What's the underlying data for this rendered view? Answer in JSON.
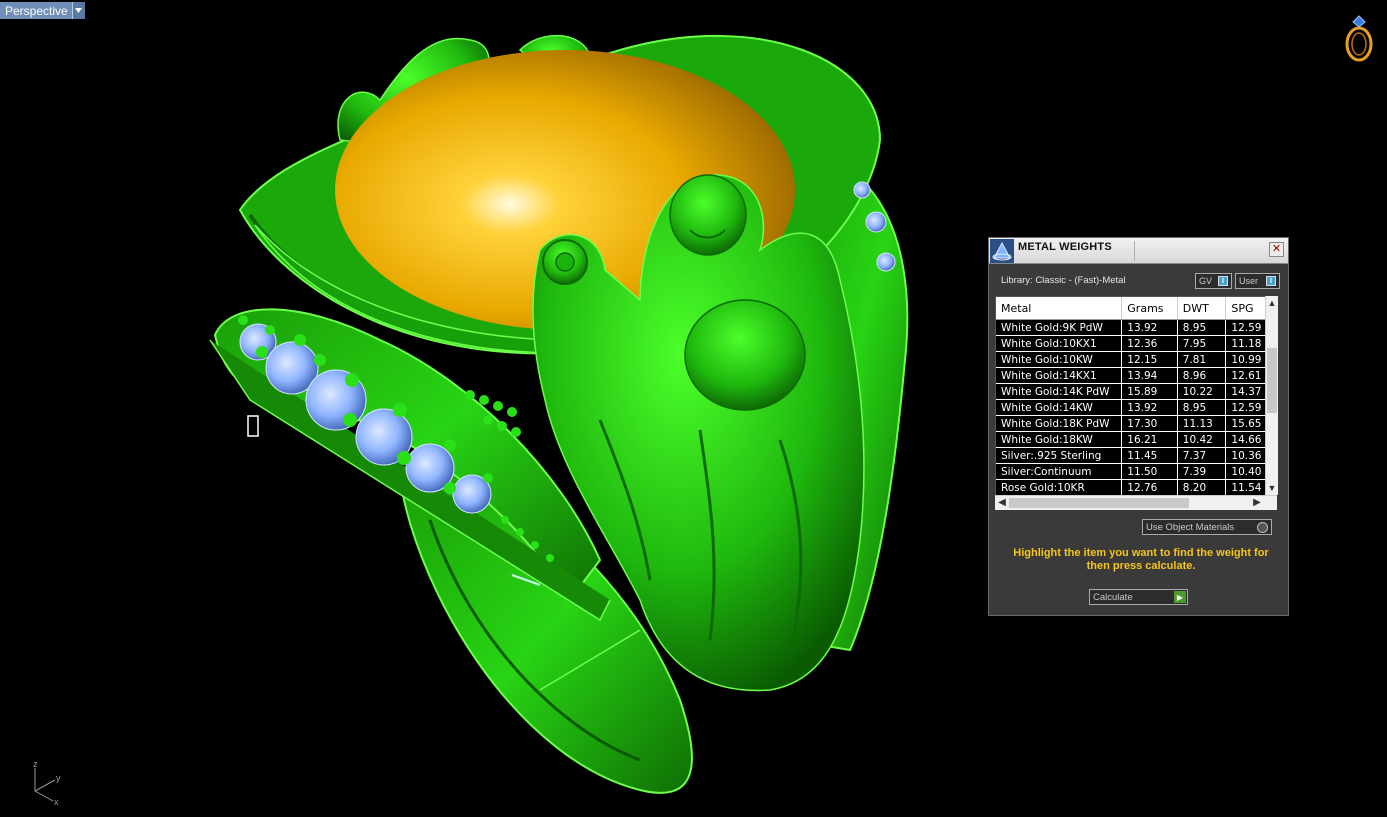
{
  "viewport": {
    "name": "Perspective",
    "axes": {
      "z": "z",
      "y": "y",
      "x": "x"
    }
  },
  "panel": {
    "title": "METAL WEIGHTS",
    "close_label": "✕",
    "library_label": "Library: Classic - (Fast)-Metal",
    "gv_label": "GV",
    "user_label": "User",
    "columns": [
      "Metal",
      "Grams",
      "DWT",
      "SPG"
    ],
    "rows": [
      [
        "White Gold:9K PdW",
        "13.92",
        "8.95",
        "12.59"
      ],
      [
        "White Gold:10KX1",
        "12.36",
        "7.95",
        "11.18"
      ],
      [
        "White Gold:10KW",
        "12.15",
        "7.81",
        "10.99"
      ],
      [
        "White Gold:14KX1",
        "13.94",
        "8.96",
        "12.61"
      ],
      [
        "White Gold:14K PdW",
        "15.89",
        "10.22",
        "14.37"
      ],
      [
        "White Gold:14KW",
        "13.92",
        "8.95",
        "12.59"
      ],
      [
        "White Gold:18K PdW",
        "17.30",
        "11.13",
        "15.65"
      ],
      [
        "White Gold:18KW",
        "16.21",
        "10.42",
        "14.66"
      ],
      [
        "Silver:.925 Sterling",
        "11.45",
        "7.37",
        "10.36"
      ],
      [
        "Silver:Continuum",
        "11.50",
        "7.39",
        "10.40"
      ],
      [
        "Rose Gold:10KR",
        "12.76",
        "8.20",
        "11.54"
      ]
    ],
    "use_object_materials": "Use Object Materials",
    "hint": "Highlight the item you want to find the weight for then press calculate.",
    "calculate_label": "Calculate"
  },
  "colors": {
    "model_green": "#22dd11",
    "gem_yellow": "#e8a800",
    "stone_blue": "#8fb4ff",
    "hint_text": "#f5c518",
    "viewport_tab": "#6f8fb8"
  },
  "icons": [
    "chevron-down-icon",
    "ring-icon",
    "axes-icon",
    "panel-logo-icon",
    "close-icon",
    "scroll-up-icon",
    "scroll-down-icon",
    "scroll-left-icon",
    "scroll-right-icon",
    "play-icon"
  ]
}
